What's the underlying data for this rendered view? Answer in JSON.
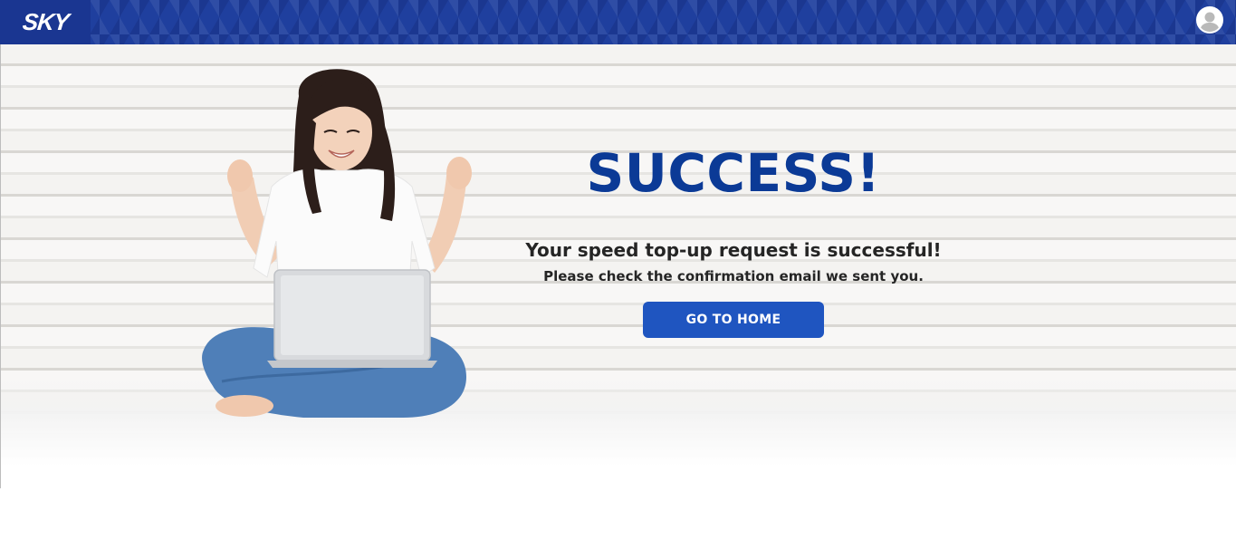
{
  "header": {
    "logo_text": "SKY",
    "avatar_icon": "user-avatar-icon",
    "colors": {
      "header_bg": "#1f3f9e",
      "logo_bg": "#1a3691"
    }
  },
  "hero": {
    "illustration": "woman-with-laptop-celebrating",
    "title": "SUCCESS!",
    "subtitle": "Your speed top-up request is successful!",
    "note": "Please check the confirmation email we sent you.",
    "button_label": "GO TO HOME",
    "colors": {
      "title": "#0b3a96",
      "button_bg": "#1f55c0",
      "button_text": "#ffffff"
    }
  }
}
